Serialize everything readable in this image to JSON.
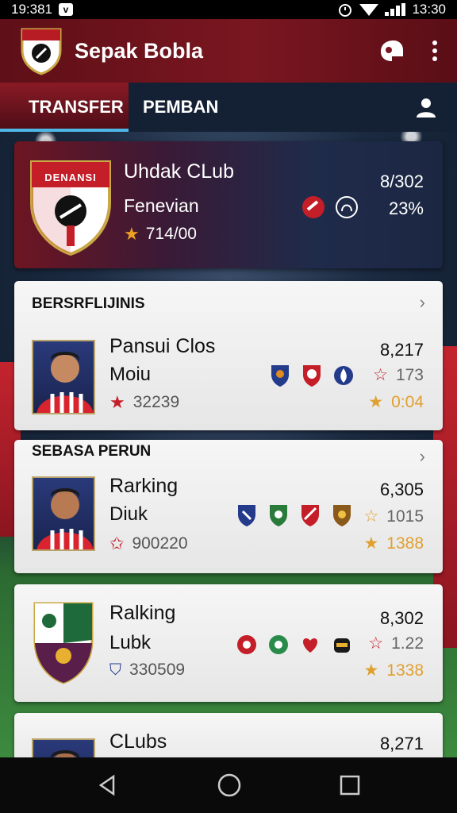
{
  "status_bar": {
    "time_left": "19:381",
    "time_right": "13:30"
  },
  "app": {
    "title": "Sepak Bobla",
    "brand_color": "#7a1620",
    "accent_color": "#4fb7e6"
  },
  "tabs": [
    {
      "label": "TRANSFER"
    },
    {
      "label": "PEMBAN"
    }
  ],
  "hero": {
    "crest_text": "DENANSI",
    "name": "Uhdak CLub",
    "subtitle": "Fenevian",
    "rating": "714/00",
    "value1": "8/302",
    "value2": "23%"
  },
  "sections": [
    {
      "header": "BERSRFLIJINIS",
      "player": {
        "name": "Pansui Clos",
        "sub": "Moiu",
        "rating": "32239",
        "value": "8,217",
        "stat1": "173",
        "stat2": "0:04"
      }
    },
    {
      "header": "SEBASA PERUN",
      "player": {
        "name": "Rarking",
        "sub": "Diuk",
        "rating": "900220",
        "value": "6,305",
        "stat1": "1015",
        "stat2": "1388"
      }
    },
    {
      "header": "",
      "player": {
        "name": "Ralking",
        "sub": "Lubk",
        "rating": "330509",
        "value": "8,302",
        "stat1": "1.22",
        "stat2": "1338"
      }
    },
    {
      "header": "",
      "player": {
        "name": "CLubs",
        "value": "8,271"
      }
    }
  ]
}
